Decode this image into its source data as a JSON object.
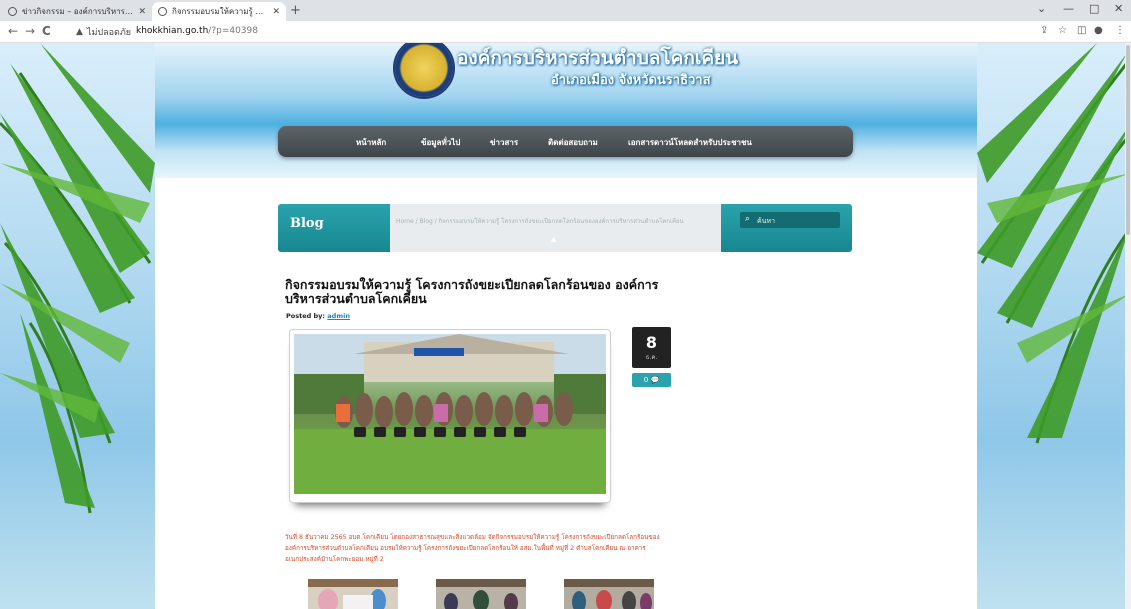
{
  "browser": {
    "tabs": [
      {
        "title": "ข่าวกิจกรรม – องค์การบริหารส่วนตำบล",
        "active": false
      },
      {
        "title": "กิจกรรมอบรมให้ความรู้ โครงการถังขยะ",
        "active": true
      }
    ],
    "new_tab": "+",
    "security_label": "ไม่ปลอดภัย",
    "url_host": "khokkhian.go.th",
    "url_path": "/?p=40398",
    "window_controls": [
      "⌄",
      "—",
      "□",
      "✕"
    ]
  },
  "site": {
    "title": "องค์การบริหารส่วนตำบลโคกเคียน",
    "subtitle": "อำเภอเมือง  จังหวัดนราธิวาส"
  },
  "menu": {
    "items": [
      "หน้าหลัก",
      "ข้อมูลทั่วไป",
      "ข่าวสาร",
      "ติดต่อสอบถาม",
      "เอกสารดาวน์โหลดสำหรับประชาชน"
    ]
  },
  "blogbar": {
    "title": "Blog",
    "breadcrumb": "Home  /  Blog  /  กิจกรรมอบรมให้ความรู้ โครงการถังขยะเปียกลดโลกร้อนขององค์การบริหารส่วนตำบลโคกเคียน",
    "search_placeholder": "ค้นหา"
  },
  "post": {
    "title": "กิจกรรมอบรมให้ความรู้ โครงการถังขยะเปียกลดโลกร้อนของ องค์การบริหารส่วนตำบลโคกเคียน",
    "posted_by_label": "Posted by:",
    "author": "admin",
    "date_day": "8",
    "date_month": "ธ.ค.",
    "comments": "0",
    "body": "วันที่ 8 ธันวาคม 2565  อบต.โคกเคียน โดยกองสาธารณสุขและสิ่งแวดล้อม จัดกิจกรรมอบรมให้ความรู้ โครงการถังขยะเปียกลดโลกร้อนขององค์การบริหารส่วนตำบลโคกเคียน อบรมให้ความรู้ โครงการถังขยะเปียกลดโลกร้อนให้ อสม.ในพื้นที่ หมู่ที่ 2 ตำบลโคกเคียน ณ อาคารอเนกประสงค์บ้านโคกพะยอม หมู่ที่ 2"
  },
  "colors": {
    "teal": "#2aa3ac",
    "menu_bg": "#4a5154",
    "body_text": "#d64a2a",
    "link": "#1a84c8"
  }
}
